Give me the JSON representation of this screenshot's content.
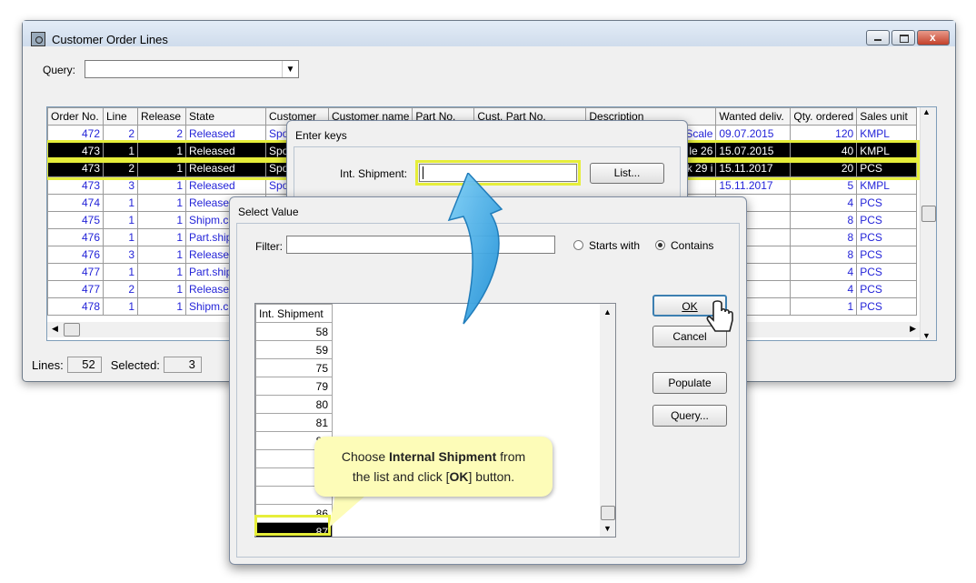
{
  "main_window": {
    "title": "Customer Order Lines",
    "query_label": "Query:",
    "query_value": "",
    "columns": [
      "Order No.",
      "Line",
      "Release",
      "State",
      "Customer",
      "Customer name",
      "Part No.",
      "Cust. Part No.",
      "Description",
      "Wanted deliv.",
      "Qty. ordered",
      "Sales unit"
    ],
    "rows": [
      {
        "order": "472",
        "line": "2",
        "release": "2",
        "state": "Released",
        "customer": "Spo",
        "desc_tail": "Scale",
        "wanted": "09.07.2015",
        "qty": "120",
        "unit": "KMPL",
        "selected": false
      },
      {
        "order": "473",
        "line": "1",
        "release": "1",
        "state": "Released",
        "customer": "Spo",
        "desc_tail": "le 26",
        "wanted": "15.07.2015",
        "qty": "40",
        "unit": "KMPL",
        "selected": true
      },
      {
        "order": "473",
        "line": "2",
        "release": "1",
        "state": "Released",
        "customer": "Spo",
        "desc_tail": "k 29 i",
        "wanted": "15.11.2017",
        "qty": "20",
        "unit": "PCS",
        "selected": true
      },
      {
        "order": "473",
        "line": "3",
        "release": "1",
        "state": "Released",
        "customer": "Spo",
        "desc_tail": "",
        "wanted": "15.11.2017",
        "qty": "5",
        "unit": "KMPL",
        "selected": false
      },
      {
        "order": "474",
        "line": "1",
        "release": "1",
        "state": "Releasec",
        "customer": "",
        "desc_tail": "",
        "wanted": "2017",
        "qty": "4",
        "unit": "PCS",
        "selected": false
      },
      {
        "order": "475",
        "line": "1",
        "release": "1",
        "state": "Shipm.cr",
        "customer": "",
        "desc_tail": "",
        "wanted": "2017",
        "qty": "8",
        "unit": "PCS",
        "selected": false
      },
      {
        "order": "476",
        "line": "1",
        "release": "1",
        "state": "Part.ship",
        "customer": "",
        "desc_tail": "",
        "wanted": "2017",
        "qty": "8",
        "unit": "PCS",
        "selected": false
      },
      {
        "order": "476",
        "line": "3",
        "release": "1",
        "state": "Releasec",
        "customer": "",
        "desc_tail": "",
        "wanted": "2017",
        "qty": "8",
        "unit": "PCS",
        "selected": false
      },
      {
        "order": "477",
        "line": "1",
        "release": "1",
        "state": "Part.ship",
        "customer": "",
        "desc_tail": "",
        "wanted": "2017",
        "qty": "4",
        "unit": "PCS",
        "selected": false
      },
      {
        "order": "477",
        "line": "2",
        "release": "1",
        "state": "Releasec",
        "customer": "",
        "desc_tail": "",
        "wanted": "2017",
        "qty": "4",
        "unit": "PCS",
        "selected": false
      },
      {
        "order": "478",
        "line": "1",
        "release": "1",
        "state": "Shipm.cr",
        "customer": "",
        "desc_tail": "",
        "wanted": "2017",
        "qty": "1",
        "unit": "PCS",
        "selected": false
      }
    ],
    "status": {
      "lines_label": "Lines:",
      "lines_value": "52",
      "selected_label": "Selected:",
      "selected_value": "3"
    }
  },
  "enter_keys": {
    "title": "Enter keys",
    "field_label": "Int. Shipment:",
    "field_value": "",
    "list_button": "List..."
  },
  "select_value": {
    "title": "Select Value",
    "filter_label": "Filter:",
    "filter_value": "",
    "starts_with": "Starts with",
    "contains": "Contains",
    "column": "Int. Shipment",
    "items": [
      "58",
      "59",
      "75",
      "79",
      "80",
      "81",
      "82",
      "",
      "",
      "",
      "86",
      "87"
    ],
    "buttons": {
      "ok": "OK",
      "cancel": "Cancel",
      "populate": "Populate",
      "query": "Query..."
    }
  },
  "callout": {
    "line1_pre": "Choose ",
    "line1_bold": "Internal Shipment",
    "line1_post": " from",
    "line2_pre": "the list and click [",
    "line2_bold": "OK",
    "line2_post": "] button."
  },
  "colors": {
    "accent_highlight": "#e6ee3a",
    "link_text": "#2323d8",
    "arrow": "#3aa6e6",
    "callout_bg": "#fdfcb8"
  }
}
